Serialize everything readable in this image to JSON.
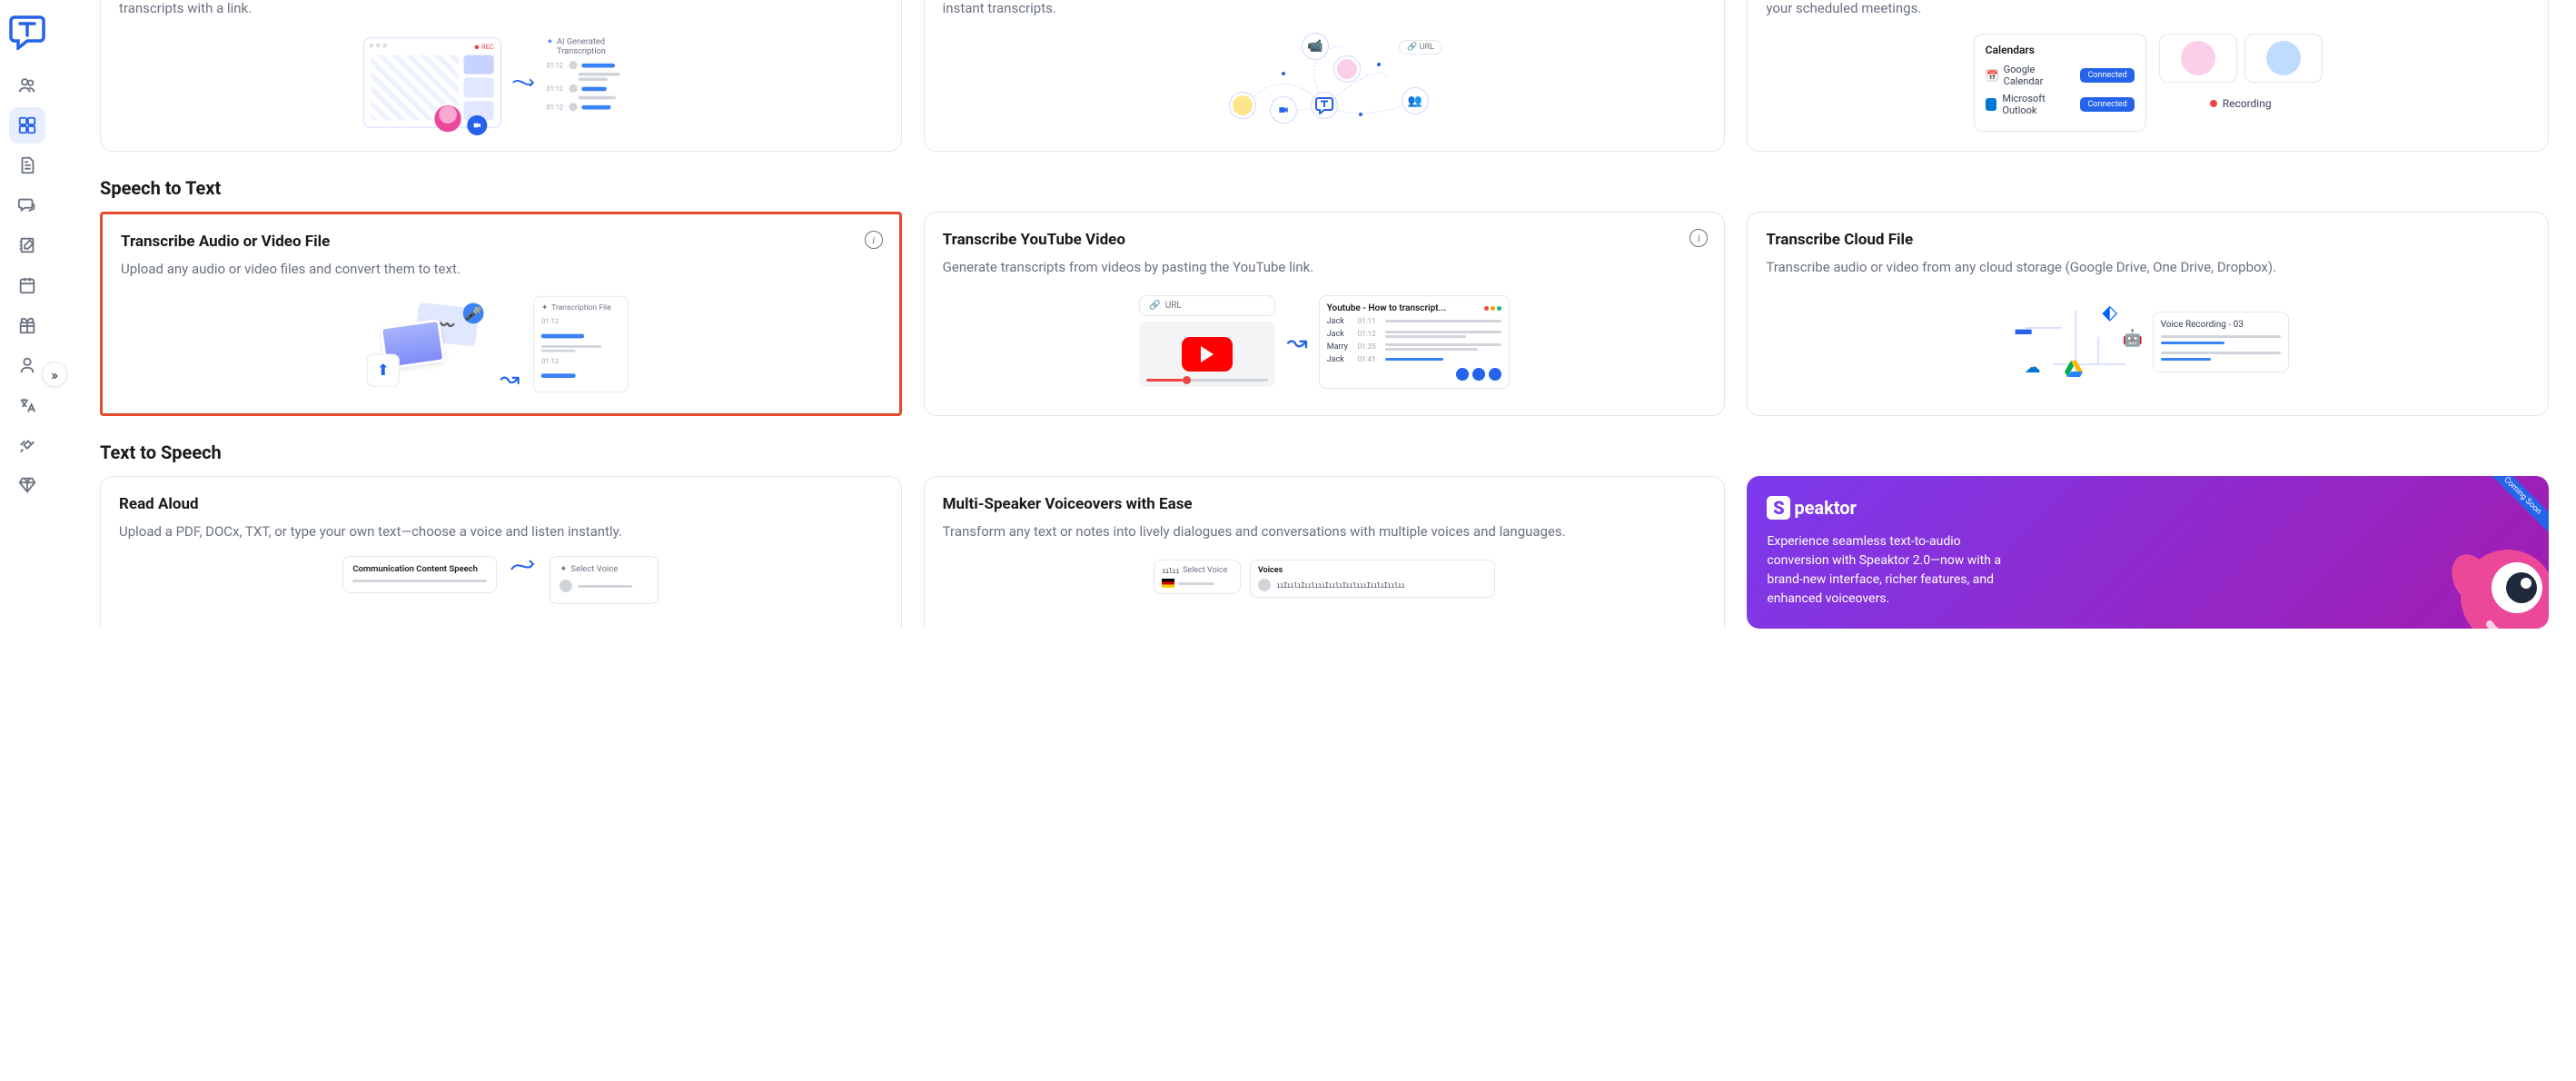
{
  "sidebar": {
    "expand": "»"
  },
  "top": {
    "desc1": "transcripts with a link.",
    "desc2": "instant transcripts.",
    "desc3": "your scheduled meetings.",
    "rec_badge": "REC",
    "ai_trans": "AI Generated Transcription",
    "ts1": "01:12",
    "ts2": "01:12",
    "ts3": "01:12",
    "url_label": "URL",
    "calendars": "Calendars",
    "gcal": "Google Calendar",
    "outlook": "Microsoft Outlook",
    "connected": "Connected",
    "recording": "Recording"
  },
  "sections": {
    "stt": "Speech to Text",
    "tts": "Text to Speech"
  },
  "stt": {
    "c1_title": "Transcribe Audio or Video File",
    "c1_desc": "Upload any audio or video files and convert them to text.",
    "c1_file": "Transcription File",
    "c1_ts1": "01:12",
    "c1_ts2": "01:12",
    "c2_title": "Transcribe YouTube Video",
    "c2_desc": "Generate transcripts from videos by pasting the YouTube link.",
    "url": "URL",
    "yt_title": "Youtube - How to transcript...",
    "jack": "Jack",
    "marry": "Marry",
    "t_0111": "01:11",
    "t_0112": "01:12",
    "t_0135": "01:35",
    "t_0141": "01:41",
    "c3_title": "Transcribe Cloud File",
    "c3_desc": "Transcribe audio or video from any cloud storage (Google Drive, One Drive, Dropbox).",
    "vr": "Voice Recording - 03"
  },
  "tts": {
    "c1_title": "Read Aloud",
    "c1_desc": "Upload a PDF, DOCx, TXT, or type your own text—choose a voice and listen instantly.",
    "doc_h": "Communication Content Speech",
    "select_voice": "Select Voice",
    "c2_title": "Multi-Speaker Voiceovers with Ease",
    "c2_desc": "Transform any text or notes into lively dialogues and conversations with multiple voices and languages.",
    "voices": "Voices"
  },
  "speaktor": {
    "brand": "peaktor",
    "desc": "Experience seamless text-to-audio conversion with Speaktor 2.0—now with a brand-new interface, richer features, and enhanced voiceovers.",
    "badge": "Coming Soon"
  }
}
